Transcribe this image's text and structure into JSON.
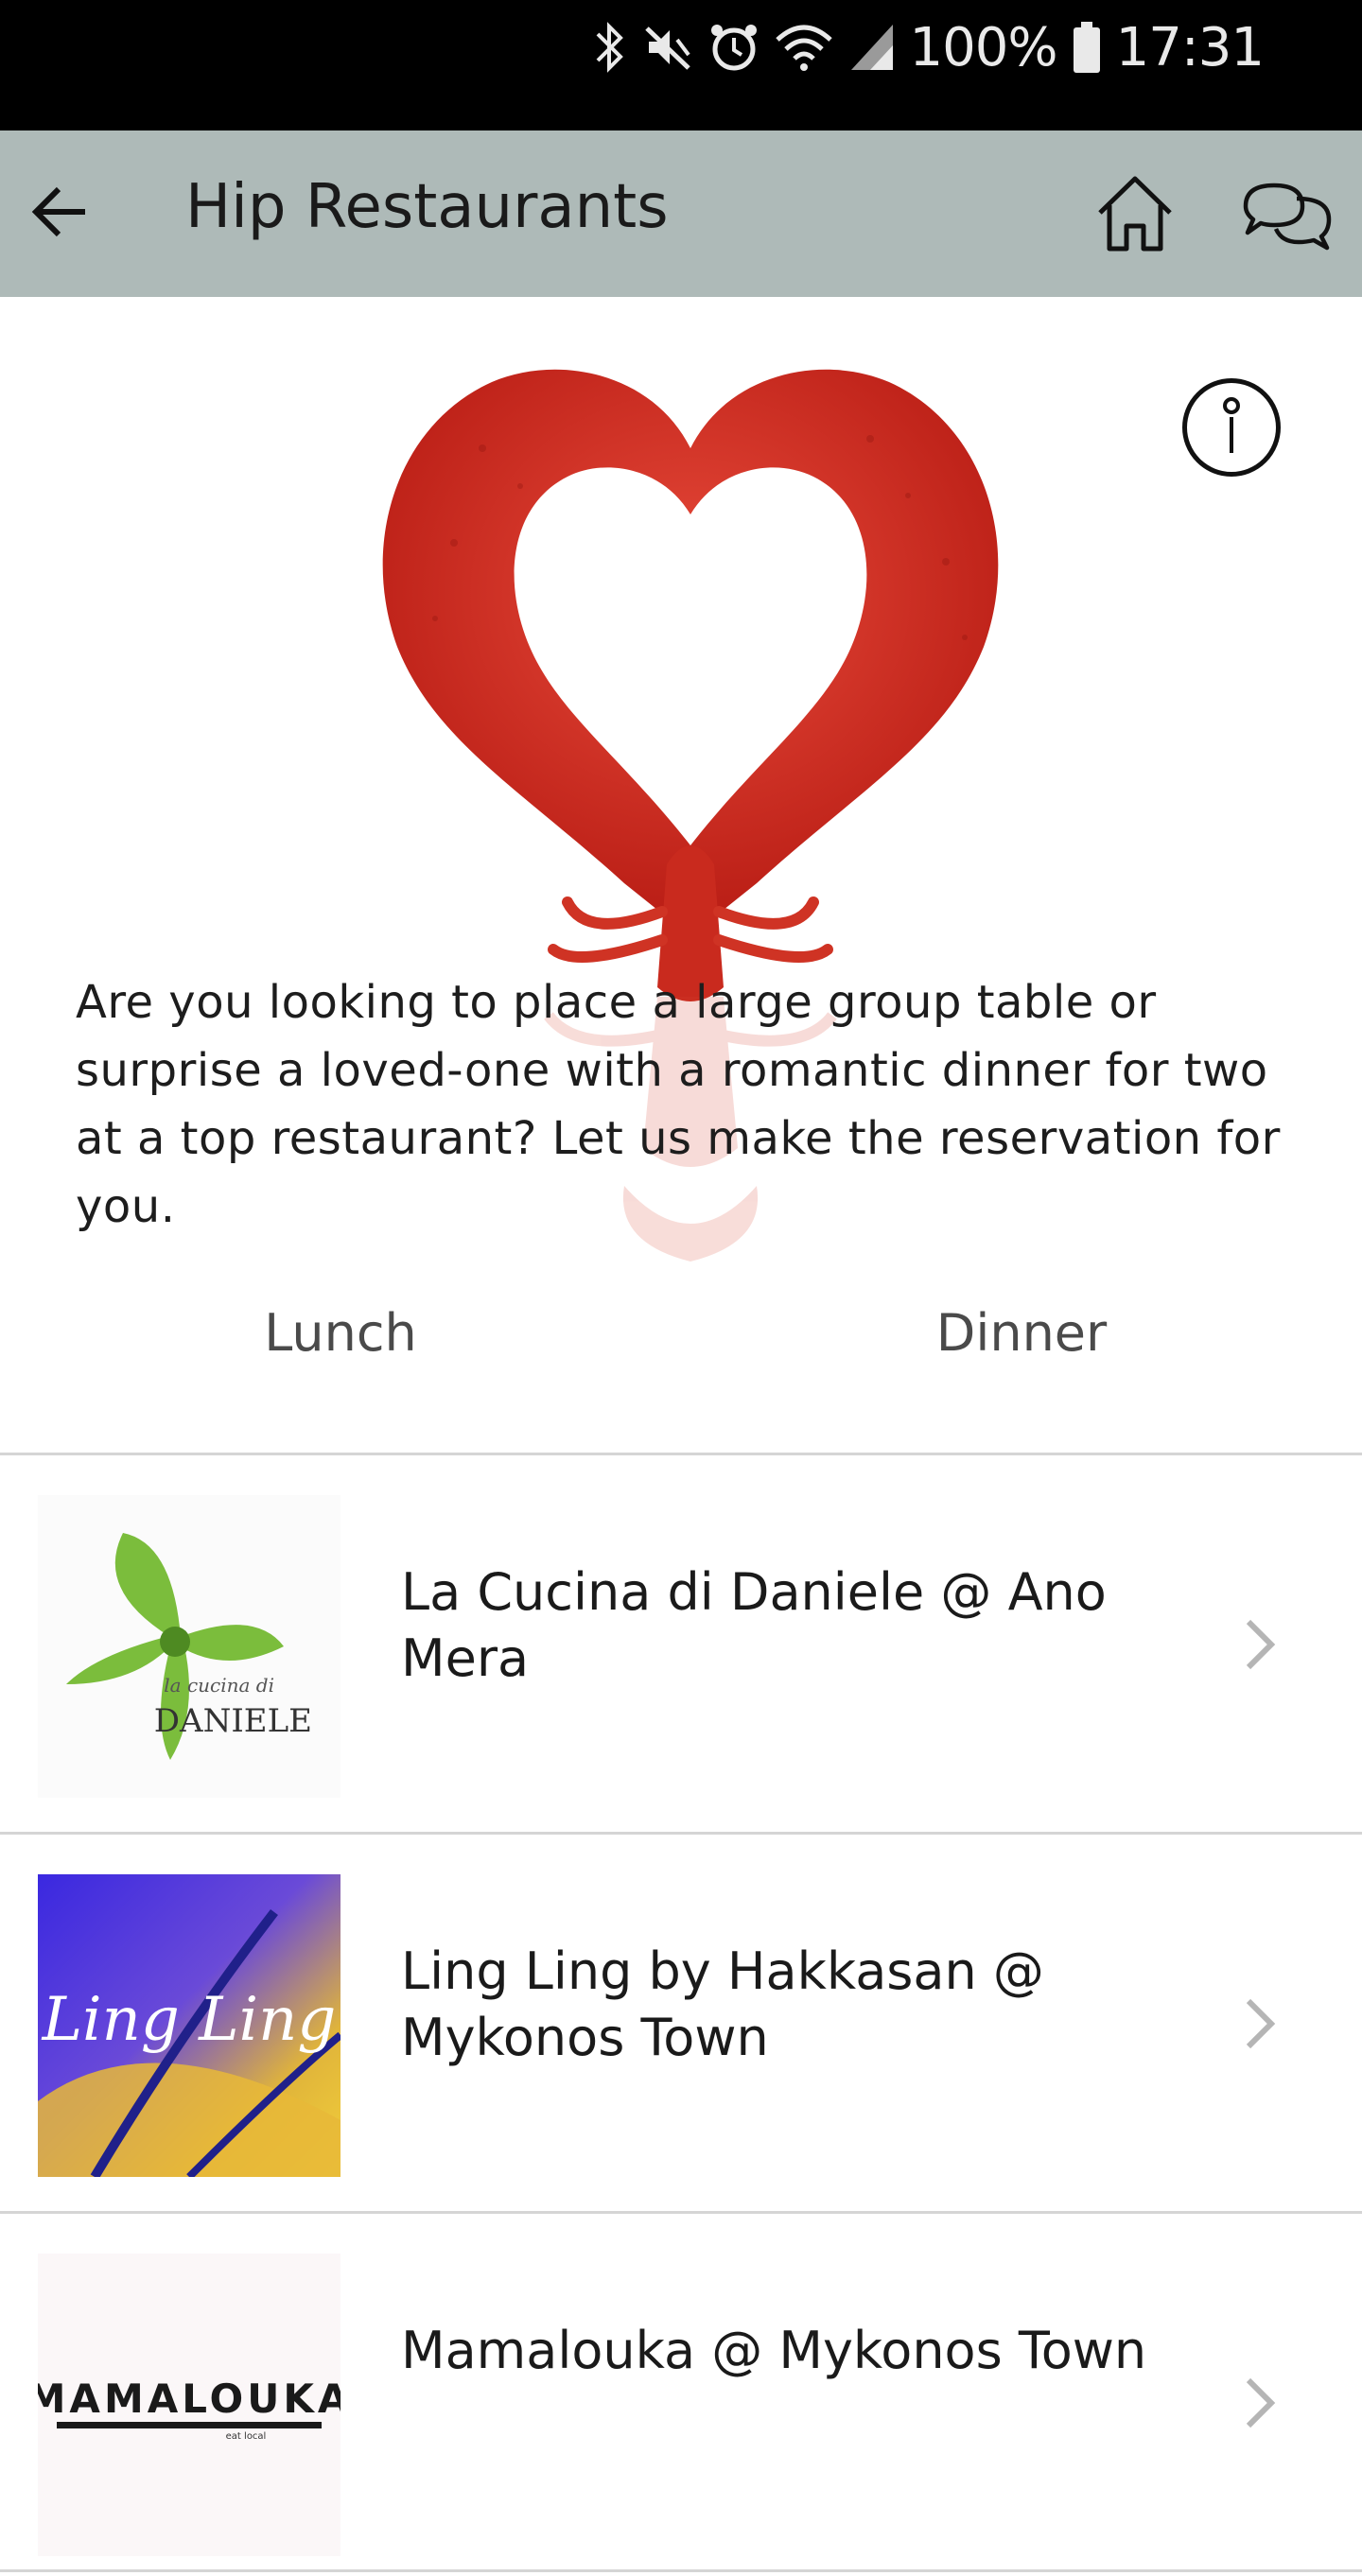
{
  "status_bar": {
    "battery_text": "100%",
    "time": "17:31",
    "icons": [
      "bluetooth-icon",
      "mute-icon",
      "alarm-icon",
      "wifi-icon",
      "signal-icon",
      "battery-icon"
    ]
  },
  "app_bar": {
    "title": "Hip Restaurants",
    "background": "#aebab8",
    "icons": [
      "back-arrow-icon",
      "home-icon",
      "chat-icon"
    ]
  },
  "hero": {
    "description": "Are you looking to place a large group table or surprise a loved-one with a romantic dinner for two at a top restaurant? Let us make the reservation for you.",
    "info_icon": "info-icon"
  },
  "tabs": [
    {
      "label": "Lunch"
    },
    {
      "label": "Dinner"
    }
  ],
  "restaurants": [
    {
      "name": "La Cucina di Daniele @ Ano Mera",
      "logo_text_1": "la cucina di",
      "logo_text_2": "DANIELE"
    },
    {
      "name": "Ling Ling by Hakkasan @ Mykonos Town",
      "logo_text_1": "Ling Ling"
    },
    {
      "name": "Mamalouka @ Mykonos Town",
      "logo_text_1": "MAMALOUKA",
      "logo_text_2": "eat local"
    }
  ]
}
